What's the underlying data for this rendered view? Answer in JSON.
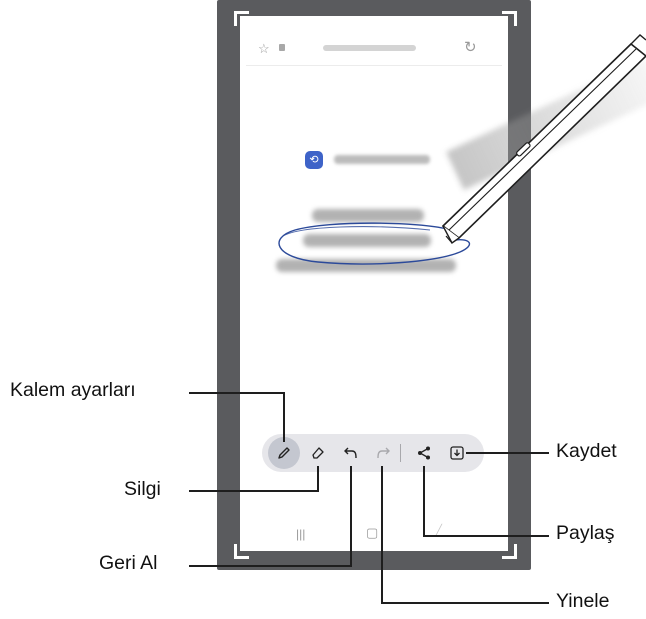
{
  "toolbar": {
    "tools": [
      {
        "name": "pen-settings",
        "icon": "pen-icon",
        "active": true
      },
      {
        "name": "eraser",
        "icon": "eraser-icon"
      },
      {
        "name": "undo",
        "icon": "undo-icon"
      },
      {
        "name": "redo",
        "icon": "redo-icon",
        "disabled": true
      },
      {
        "name": "share",
        "icon": "share-icon"
      },
      {
        "name": "save",
        "icon": "download-icon"
      }
    ]
  },
  "callouts": {
    "pen_settings": "Kalem ayarları",
    "eraser": "Silgi",
    "undo": "Geri Al",
    "save": "Kaydet",
    "share": "Paylaş",
    "redo": "Yinele"
  },
  "colors": {
    "phone_frame": "#5a5b5e",
    "toolbar_bg": "#e6e6ea",
    "active_tool_bg": "#c4c7d0",
    "ink": "#2c4a9a",
    "logo": "#3e63c8"
  }
}
